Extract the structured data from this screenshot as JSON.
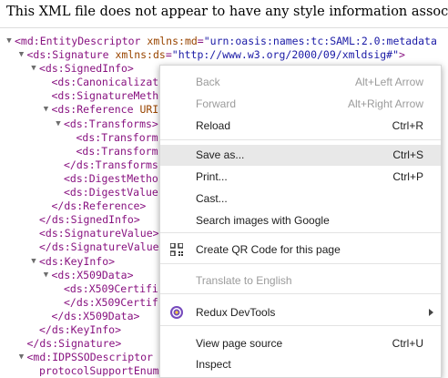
{
  "notice": "This XML file does not appear to have any style information associated with",
  "xml_lines": [
    {
      "indent": 0,
      "toggle": "▼",
      "tag": "<md:EntityDescriptor",
      "attr": " xmlns:md",
      "eq": "=",
      "val": "\"urn:oasis:names:tc:SAML:2.0:metadata",
      "end": ""
    },
    {
      "indent": 1,
      "toggle": "▼",
      "tag": "<ds:Signature",
      "attr": " xmlns:ds",
      "eq": "=",
      "val": "\"http://www.w3.org/2000/09/xmldsig#\"",
      "end": ">"
    },
    {
      "indent": 2,
      "toggle": "▼",
      "tag": "<ds:SignedInfo>",
      "attr": "",
      "eq": "",
      "val": "",
      "end": ""
    },
    {
      "indent": 3,
      "toggle": "",
      "tag": "<ds:Canonicalizat",
      "attr": "",
      "eq": "",
      "val": "",
      "end": ""
    },
    {
      "indent": 3,
      "toggle": "",
      "tag": "<ds:SignatureMeth",
      "attr": "",
      "eq": "",
      "val": "",
      "end": ""
    },
    {
      "indent": 3,
      "toggle": "▼",
      "tag": "<ds:Reference",
      "attr": " URI",
      "eq": "",
      "val": "",
      "end": ""
    },
    {
      "indent": 4,
      "toggle": "▼",
      "tag": "<ds:Transforms>",
      "attr": "",
      "eq": "",
      "val": "",
      "end": ""
    },
    {
      "indent": 5,
      "toggle": "",
      "tag": "<ds:Transform",
      "attr": "",
      "eq": "",
      "val": "",
      "end": ""
    },
    {
      "indent": 5,
      "toggle": "",
      "tag": "<ds:Transform",
      "attr": "",
      "eq": "",
      "val": "",
      "end": ""
    },
    {
      "indent": 4,
      "toggle": "",
      "tag": "</ds:Transforms",
      "attr": "",
      "eq": "",
      "val": "",
      "end": ""
    },
    {
      "indent": 4,
      "toggle": "",
      "tag": "<ds:DigestMetho",
      "attr": "",
      "eq": "",
      "val": "",
      "end": ""
    },
    {
      "indent": 4,
      "toggle": "",
      "tag": "<ds:DigestValue",
      "attr": "",
      "eq": "",
      "val": "",
      "end": ""
    },
    {
      "indent": 3,
      "toggle": "",
      "tag": "</ds:Reference>",
      "attr": "",
      "eq": "",
      "val": "",
      "end": ""
    },
    {
      "indent": 2,
      "toggle": "",
      "tag": "</ds:SignedInfo>",
      "attr": "",
      "eq": "",
      "val": "",
      "end": ""
    },
    {
      "indent": 2,
      "toggle": "",
      "tag": "<ds:SignatureValue>",
      "attr": "",
      "eq": "",
      "val": "",
      "end": ""
    },
    {
      "indent": 2,
      "toggle": "",
      "tag": "</ds:SignatureValue>",
      "attr": "",
      "eq": "",
      "val": "",
      "end": ""
    },
    {
      "indent": 2,
      "toggle": "▼",
      "tag": "<ds:KeyInfo>",
      "attr": "",
      "eq": "",
      "val": "",
      "end": ""
    },
    {
      "indent": 3,
      "toggle": "▼",
      "tag": "<ds:X509Data>",
      "attr": "",
      "eq": "",
      "val": "",
      "end": ""
    },
    {
      "indent": 4,
      "toggle": "",
      "tag": "<ds:X509Certifi",
      "attr": "",
      "eq": "",
      "val": "",
      "end": ""
    },
    {
      "indent": 4,
      "toggle": "",
      "tag": "</ds:X509Certif",
      "attr": "",
      "eq": "",
      "val": "",
      "end": ""
    },
    {
      "indent": 3,
      "toggle": "",
      "tag": "</ds:X509Data>",
      "attr": "",
      "eq": "",
      "val": "",
      "end": ""
    },
    {
      "indent": 2,
      "toggle": "",
      "tag": "</ds:KeyInfo>",
      "attr": "",
      "eq": "",
      "val": "",
      "end": ""
    },
    {
      "indent": 1,
      "toggle": "",
      "tag": "</ds:Signature>",
      "attr": "",
      "eq": "",
      "val": "",
      "end": ""
    },
    {
      "indent": 1,
      "toggle": "▼",
      "tag": "<md:IDPSSODescriptor",
      "attr": "",
      "eq": "",
      "val": "",
      "end": ""
    },
    {
      "indent": 2,
      "toggle": "",
      "tag": "protocolSupportEnume",
      "attr": "",
      "eq": "",
      "val": "",
      "end": ""
    }
  ],
  "context_menu": {
    "items": [
      {
        "label": "Back",
        "shortcut": "Alt+Left Arrow",
        "disabled": true,
        "name": "menu-item-back"
      },
      {
        "label": "Forward",
        "shortcut": "Alt+Right Arrow",
        "disabled": true,
        "name": "menu-item-forward"
      },
      {
        "label": "Reload",
        "shortcut": "Ctrl+R",
        "disabled": false,
        "name": "menu-item-reload"
      },
      {
        "label": "Save as...",
        "shortcut": "Ctrl+S",
        "disabled": false,
        "highlighted": true,
        "name": "menu-item-save-as"
      },
      {
        "label": "Print...",
        "shortcut": "Ctrl+P",
        "disabled": false,
        "name": "menu-item-print"
      },
      {
        "label": "Cast...",
        "shortcut": "",
        "disabled": false,
        "name": "menu-item-cast"
      },
      {
        "label": "Search images with Google",
        "shortcut": "",
        "disabled": false,
        "name": "menu-item-search-images"
      },
      {
        "label": "Create QR Code for this page",
        "shortcut": "",
        "disabled": false,
        "icon": "qr-code-icon",
        "name": "menu-item-create-qr"
      },
      {
        "label": "Translate to English",
        "shortcut": "",
        "disabled": true,
        "name": "menu-item-translate"
      },
      {
        "label": "Redux DevTools",
        "shortcut": "",
        "disabled": false,
        "icon": "redux-devtools-icon",
        "submenu": true,
        "name": "menu-item-redux-devtools"
      },
      {
        "label": "View page source",
        "shortcut": "Ctrl+U",
        "disabled": false,
        "name": "menu-item-view-source"
      },
      {
        "label": "Inspect",
        "shortcut": "",
        "disabled": false,
        "name": "menu-item-inspect"
      }
    ]
  },
  "colors": {
    "tag": "#881280",
    "attr_name": "#994500",
    "attr_value": "#1a1aa6",
    "menu_highlight": "#e8e8e8",
    "menu_disabled": "#9b9b9b"
  }
}
